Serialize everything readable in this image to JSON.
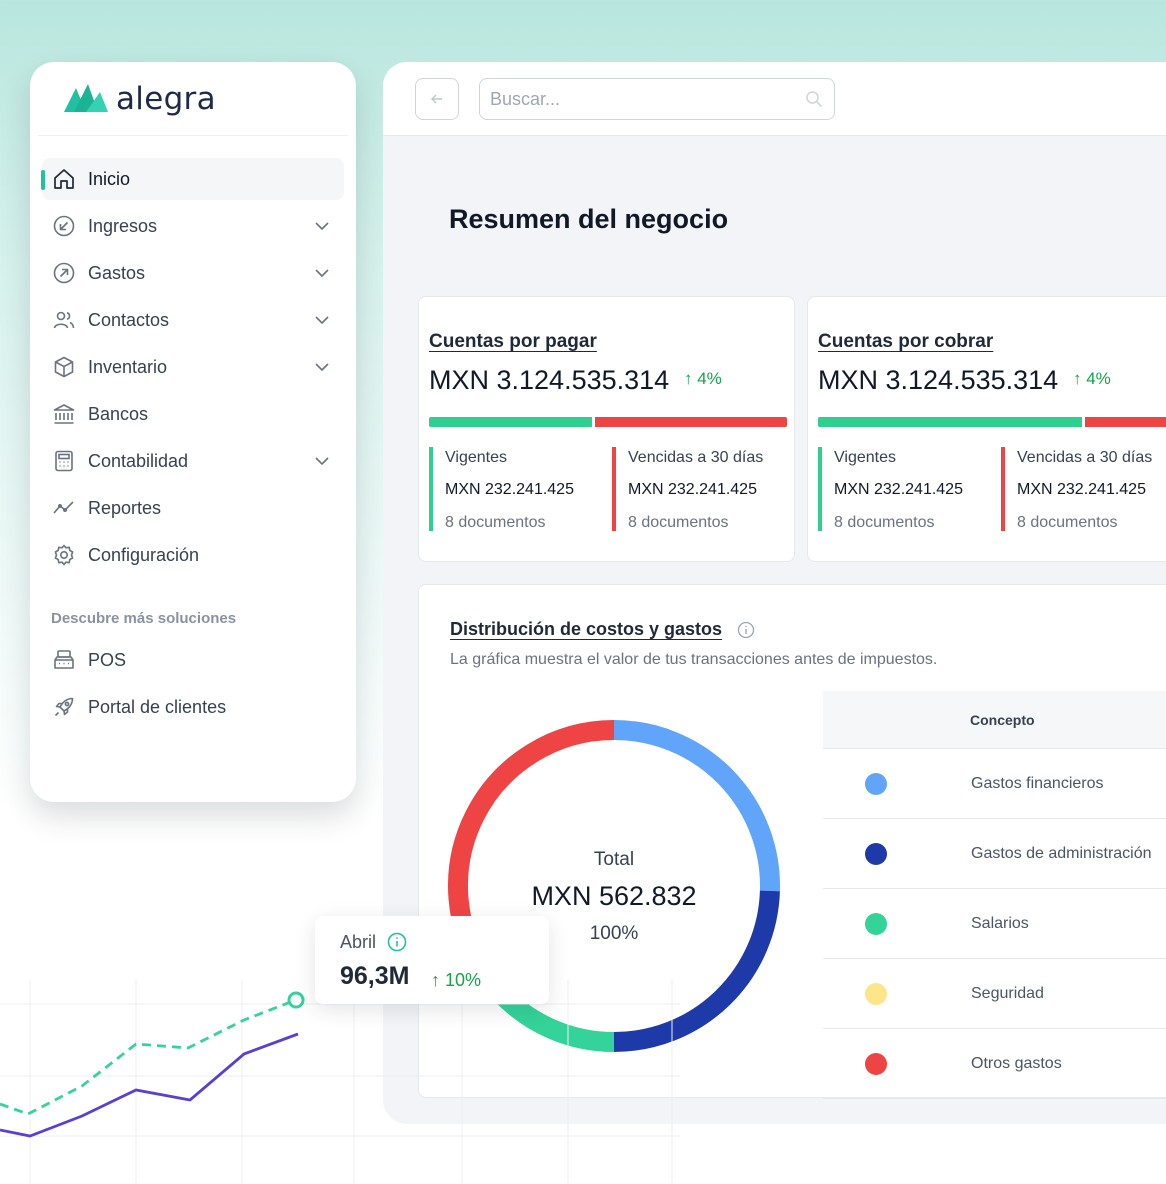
{
  "brand": {
    "name": "alegra",
    "colors": {
      "primary": "#20c1a0",
      "navy": "#1e2a47"
    }
  },
  "sidebar": {
    "items": [
      {
        "label": "Inicio",
        "icon": "home-icon",
        "active": true,
        "expandable": false
      },
      {
        "label": "Ingresos",
        "icon": "arrow-in-circle-icon",
        "expandable": true
      },
      {
        "label": "Gastos",
        "icon": "arrow-out-circle-icon",
        "expandable": true
      },
      {
        "label": "Contactos",
        "icon": "users-icon",
        "expandable": true
      },
      {
        "label": "Inventario",
        "icon": "box-icon",
        "expandable": true
      },
      {
        "label": "Bancos",
        "icon": "bank-icon",
        "expandable": false
      },
      {
        "label": "Contabilidad",
        "icon": "calculator-icon",
        "expandable": true
      },
      {
        "label": "Reportes",
        "icon": "trend-line-icon",
        "expandable": false
      },
      {
        "label": "Configuración",
        "icon": "gear-icon",
        "expandable": false
      }
    ],
    "section_title": "Descubre más soluciones",
    "solutions": [
      {
        "label": "POS",
        "icon": "register-icon"
      },
      {
        "label": "Portal de clientes",
        "icon": "rocket-icon"
      }
    ]
  },
  "topbar": {
    "search_placeholder": "Buscar..."
  },
  "page": {
    "title": "Resumen del negocio"
  },
  "kpis": [
    {
      "title": "Cuentas por pagar",
      "amount": "MXN 3.124.535.314",
      "delta": "↑ 4%",
      "bar": {
        "vigente_fraction": 0.455
      },
      "vigentes": {
        "label": "Vigentes",
        "value": "MXN 232.241.425",
        "docs": "8 documentos"
      },
      "vencidas": {
        "label": "Vencidas a 30 días",
        "value": "MXN 232.241.425",
        "docs": "8 documentos"
      }
    },
    {
      "title": "Cuentas por cobrar",
      "amount": "MXN 3.124.535.314",
      "delta": "↑ 4%",
      "bar": {
        "vigente_fraction": 0.75
      },
      "vigentes": {
        "label": "Vigentes",
        "value": "MXN 232.241.425",
        "docs": "8 documentos"
      },
      "vencidas": {
        "label": "Vencidas a 30 días",
        "value": "MXN 232.241.425",
        "docs": "8 documentos"
      }
    }
  ],
  "distribution": {
    "title": "Distribución de costos y gastos",
    "subtitle": "La gráfica muestra el valor de tus transacciones antes de impuestos.",
    "center": {
      "label": "Total",
      "amount": "MXN 562.832",
      "percent": "100%"
    },
    "table_header": "Concepto",
    "concepts": [
      {
        "label": "Gastos financieros",
        "color": "#60a5fa"
      },
      {
        "label": "Gastos de administración",
        "color": "#1e3aa8"
      },
      {
        "label": "Salarios",
        "color": "#34d399"
      },
      {
        "label": "Seguridad",
        "color": "#fde68a"
      },
      {
        "label": "Otros gastos",
        "color": "#ef4444"
      }
    ]
  },
  "chart_data": {
    "type": "donut",
    "series": [
      {
        "name": "Gastos financieros",
        "fraction": 0.255,
        "color": "#60a5fa"
      },
      {
        "name": "Gastos de administración",
        "fraction": 0.245,
        "color": "#1e3aa8"
      },
      {
        "name": "Salarios",
        "fraction": 0.13,
        "color": "#34d399"
      },
      {
        "name": "Seguridad",
        "fraction": 0.02,
        "color": "#fde68a"
      },
      {
        "name": "Otros gastos",
        "fraction": 0.35,
        "color": "#ef4444"
      }
    ]
  },
  "trend": {
    "month": "Abril",
    "value": "96,3M",
    "delta": "↑ 10%",
    "colors": {
      "dashed": "#34d399",
      "solid": "#5b3fd1"
    }
  }
}
